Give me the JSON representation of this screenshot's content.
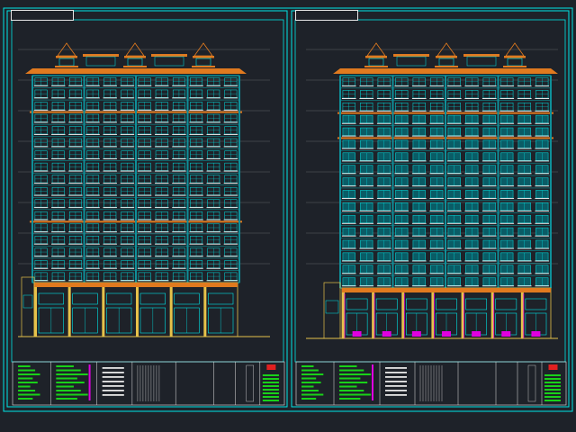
{
  "drawing": {
    "colors": {
      "background": "#1e2229",
      "frame": "#00e6e6",
      "building_lines": "#00e6e6",
      "eaves": "#e07a1f",
      "base_yellow": "#e6c24a",
      "magenta": "#e000e0",
      "green": "#19d119",
      "red": "#e02020",
      "white": "#e6e6e6",
      "grey_grid": "#8a8f96"
    },
    "sheets": [
      {
        "name": "left-elevation",
        "stamp_text": "",
        "floors": 17,
        "window_columns": 12,
        "shop_bays": 6
      },
      {
        "name": "right-elevation",
        "stamp_text": "",
        "floors": 17,
        "window_columns": 12,
        "shop_bays": 7
      }
    ]
  }
}
